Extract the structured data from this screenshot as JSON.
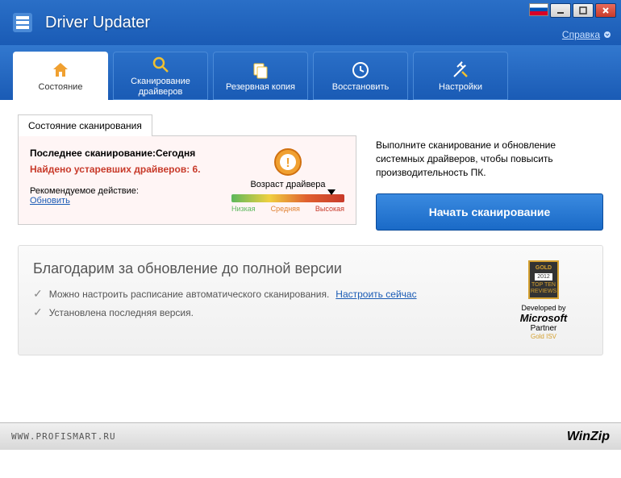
{
  "app": {
    "title": "Driver Updater",
    "help": "Справка",
    "brand": "WinZip",
    "watermark": "WWW.PROFISMART.RU"
  },
  "tabs": [
    {
      "label": "Состояние"
    },
    {
      "label": "Сканирование драйверов"
    },
    {
      "label": "Резервная копия"
    },
    {
      "label": "Восстановить"
    },
    {
      "label": "Настройки"
    }
  ],
  "status": {
    "tab_label": "Состояние сканирования",
    "last_scan_label": "Последнее сканирование:",
    "last_scan_value": "Сегодня",
    "outdated_text": "Найдено устаревших драйверов: 6.",
    "recommended_label": "Рекомендуемое действие:",
    "recommended_action": "Обновить",
    "driver_age_label": "Возраст драйвера",
    "gauge": {
      "low": "Низкая",
      "mid": "Средняя",
      "high": "Высокая"
    }
  },
  "action": {
    "description": "Выполните сканирование и обновление системных драйверов, чтобы повысить производительность ПК.",
    "button": "Начать сканирование"
  },
  "banner": {
    "title": "Благодарим за обновление до полной версии",
    "line1_text": "Можно настроить расписание автоматического сканирования.",
    "line1_link": "Настроить сейчас",
    "line2_text": "Установлена последняя версия.",
    "award_year": "2012",
    "award_src": "TOP TEN REVIEWS",
    "developed_by": "Developed by",
    "ms": "Microsoft",
    "partner": "Partner",
    "gold": "Gold ISV"
  }
}
